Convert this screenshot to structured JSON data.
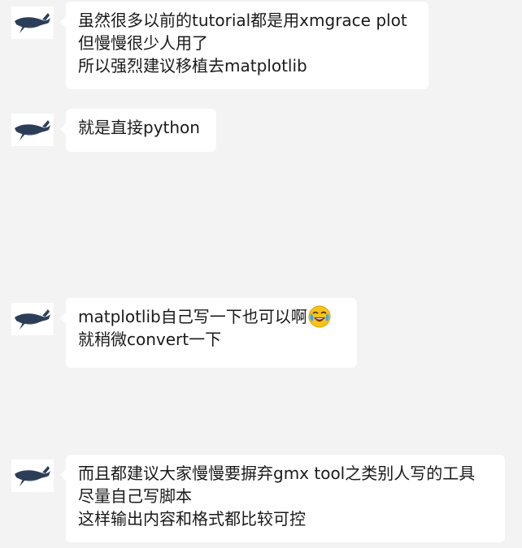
{
  "colors": {
    "background": "#f3f3f3",
    "bubble": "#ffffff",
    "text": "#1a1a1a"
  },
  "messages": [
    {
      "avatar_icon": "whale-avatar-icon",
      "lines": [
        "虽然很多以前的tutorial都是用xmgrace plot",
        "但慢慢很少人用了",
        "所以强烈建议移植去matplotlib"
      ]
    },
    {
      "avatar_icon": "whale-avatar-icon",
      "lines": [
        "就是直接python"
      ]
    },
    {
      "avatar_icon": "whale-avatar-icon",
      "lines": [
        "matplotlib自己写一下也可以啊",
        "就稍微convert一下"
      ],
      "emoji": "laughing-crying-emoji-icon"
    },
    {
      "avatar_icon": "whale-avatar-icon",
      "lines": [
        "而且都建议大家慢慢要摒弃gmx tool之类别人写的工具",
        "尽量自己写脚本",
        "这样输出内容和格式都比较可控"
      ]
    }
  ]
}
